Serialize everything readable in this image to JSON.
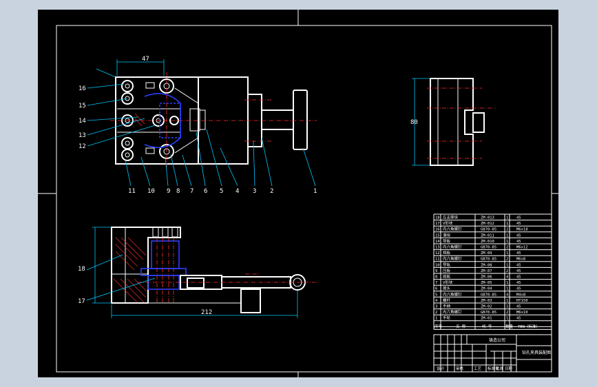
{
  "colors": {
    "background": "#c9d3e0",
    "paper": "#000000",
    "outline": "#ffffff",
    "centerline": "#ff3030",
    "dimension": "#00c8ff",
    "hidden_part": "#2a40ff"
  },
  "top_view_labels": [
    "16",
    "15",
    "14",
    "13",
    "12"
  ],
  "bottom_labels": [
    "11",
    "10",
    "9",
    "8",
    "7",
    "6",
    "5",
    "4",
    "3",
    "2",
    "1"
  ],
  "front_labels": [
    "18",
    "17"
  ],
  "dims": {
    "top_width": "47",
    "side_height": "80",
    "front_length": "212"
  },
  "bom": {
    "rows": [
      {
        "no": "18",
        "name": "左支撑块",
        "code": "ZM-013",
        "qty": "1",
        "mat": "45"
      },
      {
        "no": "17",
        "name": "V形块",
        "code": "ZM-012",
        "qty": "1",
        "mat": "45"
      },
      {
        "no": "16",
        "name": "内六角螺钉",
        "code": "GB70-85",
        "qty": "2",
        "mat": "M6x18"
      },
      {
        "no": "15",
        "name": "滑块",
        "code": "ZM-011",
        "qty": "1",
        "mat": "45"
      },
      {
        "no": "14",
        "name": "导板",
        "code": "ZM-010",
        "qty": "1",
        "mat": "45"
      },
      {
        "no": "13",
        "name": "内六角螺钉",
        "code": "GB70-85",
        "qty": "2",
        "mat": "M6x12"
      },
      {
        "no": "12",
        "name": "挡板",
        "code": "ZM-09",
        "qty": "1",
        "mat": "45"
      },
      {
        "no": "11",
        "name": "内六角螺钉",
        "code": "GB70-85",
        "qty": "2",
        "mat": "M6x8"
      },
      {
        "no": "10",
        "name": "导轨",
        "code": "ZM-08",
        "qty": "1",
        "mat": "45"
      },
      {
        "no": "9",
        "name": "压板",
        "code": "ZM-07",
        "qty": "2",
        "mat": "45"
      },
      {
        "no": "8",
        "name": "底板",
        "code": "ZM-06",
        "qty": "4",
        "mat": "45"
      },
      {
        "no": "7",
        "name": "V形块",
        "code": "ZM-05",
        "qty": "1",
        "mat": "45"
      },
      {
        "no": "6",
        "name": "接头",
        "code": "ZM-04",
        "qty": "1",
        "mat": "45"
      },
      {
        "no": "5",
        "name": "内六角螺钉",
        "code": "GB70-85",
        "qty": "4",
        "mat": "M4x8"
      },
      {
        "no": "4",
        "name": "螺杆",
        "code": "ZM-03",
        "qty": "1",
        "mat": "HT150"
      },
      {
        "no": "3",
        "name": "手柄",
        "code": "ZM-02",
        "qty": "1",
        "mat": "45"
      },
      {
        "no": "2",
        "name": "内六角螺钉",
        "code": "GB70-85",
        "qty": "2",
        "mat": "M6x10"
      },
      {
        "no": "1",
        "name": "手轮",
        "code": "ZM-01",
        "qty": "1",
        "mat": "45"
      }
    ],
    "header": {
      "no": "序号",
      "name": "名 称",
      "code": "代 号",
      "qty": "数量",
      "mat": "TBN（标准）"
    }
  },
  "title_block": {
    "company": "铸造公司",
    "drawing_title": "钻孔夹具装配图",
    "footer_labels": [
      "设计",
      "审核",
      "工艺",
      "标准化",
      "批准",
      "日期"
    ]
  }
}
